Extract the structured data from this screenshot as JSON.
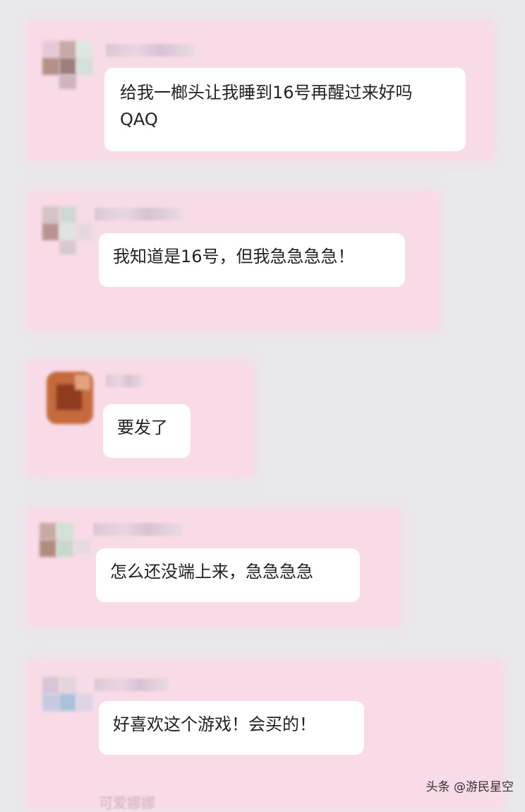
{
  "chat": {
    "messages": [
      {
        "text": "给我一榔头让我睡到16号再醒过来好吗QAQ"
      },
      {
        "text": "我知道是16号，但我急急急急！"
      },
      {
        "text": "要发了"
      },
      {
        "text": "怎么还没端上来，急急急急"
      },
      {
        "text": "好喜欢这个游戏！会买的！"
      }
    ],
    "partial_name": "可爱娜娜"
  },
  "watermark": "头条 @游民星空",
  "colors": {
    "page_bg": "#e9e9ed",
    "card_bg": "#f8dbe6",
    "bubble_bg": "#ffffff",
    "text": "#222222"
  },
  "icons": [
    "avatar-pixelated"
  ]
}
